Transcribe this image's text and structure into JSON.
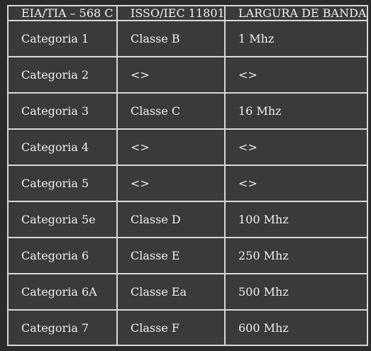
{
  "table": {
    "headers": [
      "EIA/TIA – 568 C",
      "ISSO/IEC 11801",
      "LARGURA DE BANDA"
    ],
    "rows": [
      [
        "Categoria 1",
        "Classe B",
        "1 Mhz"
      ],
      [
        "Categoria 2",
        "<>",
        "<>"
      ],
      [
        "Categoria 3",
        "Classe C",
        "16 Mhz"
      ],
      [
        "Categoria 4",
        "<>",
        "<>"
      ],
      [
        "Categoria 5",
        "<>",
        "<>"
      ],
      [
        "Categoria 5e",
        "Classe D",
        "100 Mhz"
      ],
      [
        "Categoria 6",
        "Classe E",
        "250 Mhz"
      ],
      [
        "Categoria 6A",
        "Classe Ea",
        "500 Mhz"
      ],
      [
        "Categoria 7",
        "Classe F",
        "600 Mhz"
      ]
    ]
  },
  "colors": {
    "background": "#2b2b2b",
    "cell_background": "#3a3a3a",
    "border": "#d8d8d8",
    "text": "#f0f0f0"
  }
}
